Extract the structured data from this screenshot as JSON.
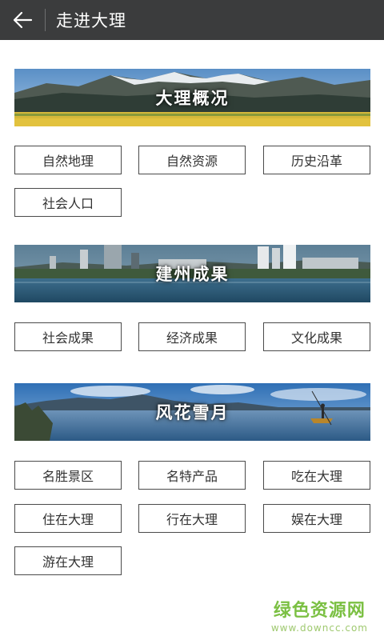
{
  "header": {
    "title": "走进大理",
    "back_icon": "arrow-left-icon"
  },
  "sections": [
    {
      "banner": "大理概况",
      "items": [
        "自然地理",
        "自然资源",
        "历史沿革",
        "社会人口"
      ]
    },
    {
      "banner": "建州成果",
      "items": [
        "社会成果",
        "经济成果",
        "文化成果"
      ]
    },
    {
      "banner": "风花雪月",
      "items": [
        "名胜景区",
        "名特产品",
        "吃在大理",
        "住在大理",
        "行在大理",
        "娱在大理",
        "游在大理"
      ]
    }
  ],
  "watermark": {
    "text": "绿色资源网",
    "url": "www.downcc.com"
  },
  "colors": {
    "header_bg": "#3b3c3d",
    "watermark": "#7bc043"
  }
}
